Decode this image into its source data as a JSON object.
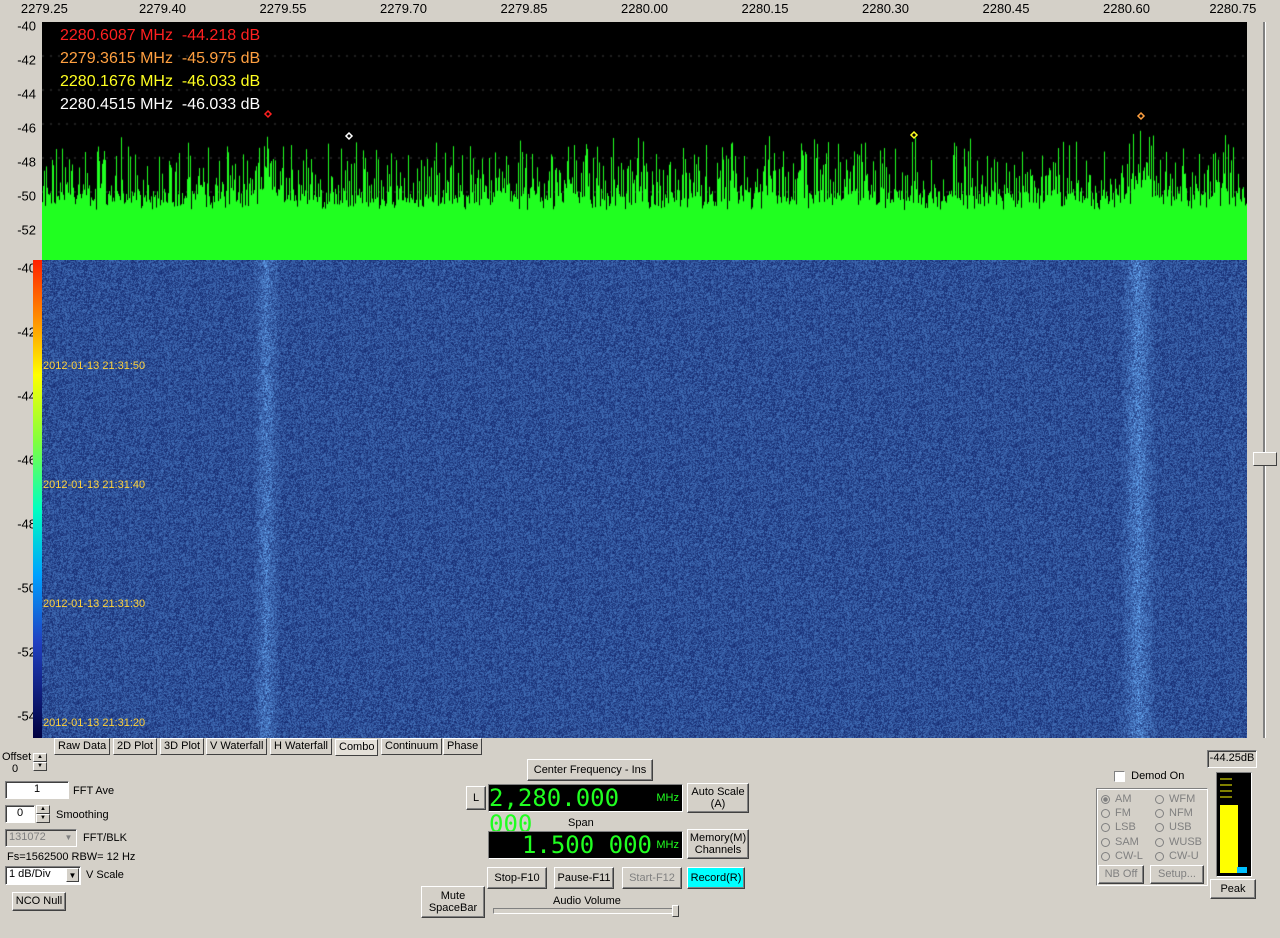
{
  "x_axis": {
    "ticks": [
      "2279.25",
      "2279.40",
      "2279.55",
      "2279.70",
      "2279.85",
      "2280.00",
      "2280.15",
      "2280.30",
      "2280.45",
      "2280.60",
      "2280.75"
    ]
  },
  "spectrum_y_ticks": [
    "-40",
    "-42",
    "-44",
    "-46",
    "-48",
    "-50",
    "-52"
  ],
  "waterfall_y_ticks": [
    "-40",
    "-42",
    "-44",
    "-46",
    "-48",
    "-50",
    "-52",
    "-54"
  ],
  "markers": [
    {
      "freq": "2280.6087 MHz",
      "level": "-44.218 dB",
      "color": "#ff2020"
    },
    {
      "freq": "2279.3615 MHz",
      "level": "-45.975 dB",
      "color": "#ffa040"
    },
    {
      "freq": "2280.1676 MHz",
      "level": "-46.033 dB",
      "color": "#ffff20"
    },
    {
      "freq": "2280.4515 MHz",
      "level": "-46.033 dB",
      "color": "#ffffff"
    }
  ],
  "timestamps": [
    "2012-01-13 21:31:50",
    "2012-01-13 21:31:40",
    "2012-01-13 21:31:30",
    "2012-01-13 21:31:20"
  ],
  "tabs": [
    "Raw Data",
    "2D Plot",
    "3D Plot",
    "V Waterfall",
    "H Waterfall",
    "Combo",
    "Continuum",
    "Phase"
  ],
  "active_tab": "Combo",
  "controls": {
    "offset_label": "Offset",
    "offset_value": "0",
    "fft_ave_value": "1",
    "fft_ave_label": "FFT Ave",
    "smoothing_value": "0",
    "smoothing_label": "Smoothing",
    "fft_blk_value": "131072",
    "fft_blk_label": "FFT/BLK",
    "fs_rbw": "Fs=1562500 RBW=  12 Hz",
    "vscale_value": "1 dB/Div",
    "vscale_label": "V Scale",
    "nco_null": "NCO Null"
  },
  "center": {
    "center_freq_button": "Center Frequency - Ins",
    "l_button": "L",
    "freq_display": "2,280.000 000",
    "freq_unit": "MHz",
    "auto_scale": "Auto Scale\n(A)",
    "span_label": "Span",
    "span_display": "1.500 000",
    "span_unit": "MHz",
    "memory": "Memory(M)\nChannels",
    "stop": "Stop-F10",
    "pause": "Pause-F11",
    "start": "Start-F12",
    "record": "Record(R)",
    "mute": "Mute\nSpaceBar",
    "audio_volume": "Audio Volume"
  },
  "demod": {
    "demod_on": "Demod On",
    "modes": [
      [
        "AM",
        "WFM"
      ],
      [
        "FM",
        "NFM"
      ],
      [
        "LSB",
        "USB"
      ],
      [
        "SAM",
        "WUSB"
      ],
      [
        "CW-L",
        "CW-U"
      ]
    ],
    "nb_off": "NB Off",
    "setup": "Setup...",
    "peak_value": "-44.25dB",
    "peak_button": "Peak"
  },
  "colors": {
    "spectrum_trace": "#20ff20",
    "waterfall_bg": "#1e2f7a",
    "record_active": "#00ffff"
  }
}
